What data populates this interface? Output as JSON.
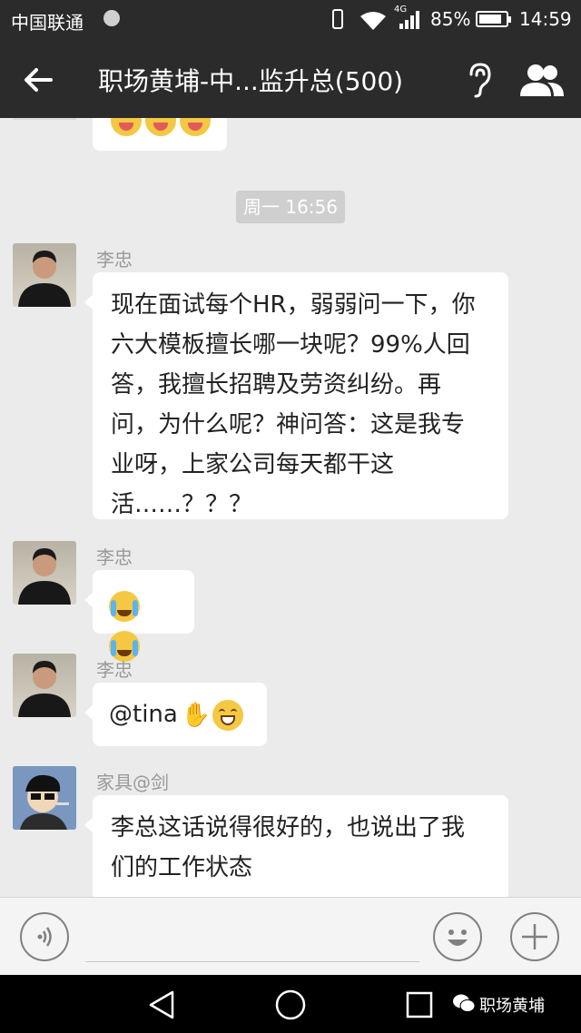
{
  "status_bar": {
    "carrier": "中国联通",
    "network": "4G",
    "battery_percent": "85%",
    "battery_level": 0.85,
    "time": "14:59"
  },
  "title_bar": {
    "title": "职场黄埔-中...监升总(500)"
  },
  "chat": {
    "timestamp": "周一 16:56",
    "messages": [
      {
        "sender": "李忠",
        "text_lines": [
          "现在面试每个HR，弱弱问一下，你",
          "六大模板擅长哪一块呢？99%人回",
          "答，我擅长招聘及劳资纠纷。再",
          "问，为什么呢？神问答：这是我专",
          "业呀，上家公司每天都干这",
          "活……？？？"
        ]
      },
      {
        "sender": "李忠",
        "emojis": [
          "facepalm-crying-emoji",
          "facepalm-crying-emoji"
        ]
      },
      {
        "sender": "李忠",
        "text": "@tina",
        "emojis": [
          "handshake-emoji",
          "grin-emoji"
        ]
      },
      {
        "sender": "家具@剑",
        "text_lines": [
          "李总这话说得很好的，也说出了我",
          "们的工作状态"
        ]
      }
    ]
  },
  "nav_bar": {
    "watermark": "职场黄埔"
  },
  "colors": {
    "header_bg": "#2b2b2b",
    "chat_bg": "#ebebeb",
    "bubble_bg": "#ffffff",
    "sender_text": "#999999",
    "timestamp_bg": "#cfcfcf"
  }
}
